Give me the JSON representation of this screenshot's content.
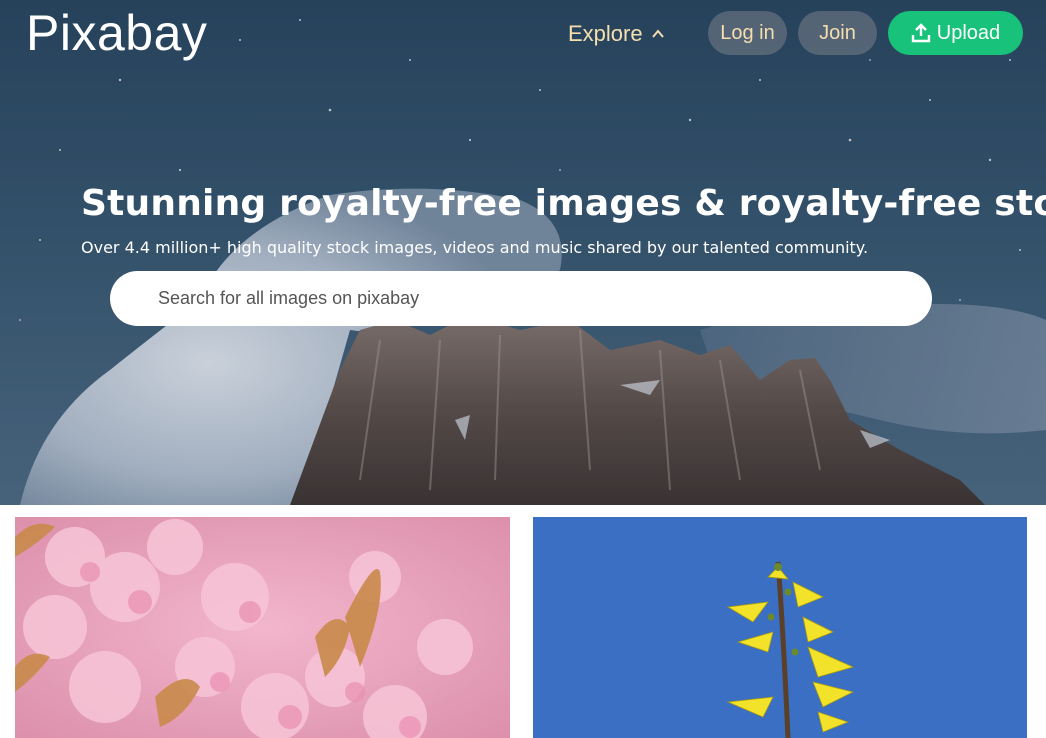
{
  "header": {
    "logo": "Pixabay",
    "explore_label": "Explore",
    "login_label": "Log in",
    "join_label": "Join",
    "upload_label": "Upload"
  },
  "hero": {
    "title": "Stunning royalty-free images & royalty-free stock",
    "subtitle": "Over 4.4 million+ high quality stock images, videos and music shared by our talented community.",
    "search_placeholder": "Search for all images on pixabay"
  },
  "colors": {
    "upload_green": "#19c27b",
    "nav_text": "#f5deb0",
    "sky_top": "#2c4a64"
  },
  "icons": {
    "explore": "chevron-up-icon",
    "upload": "upload-icon"
  }
}
